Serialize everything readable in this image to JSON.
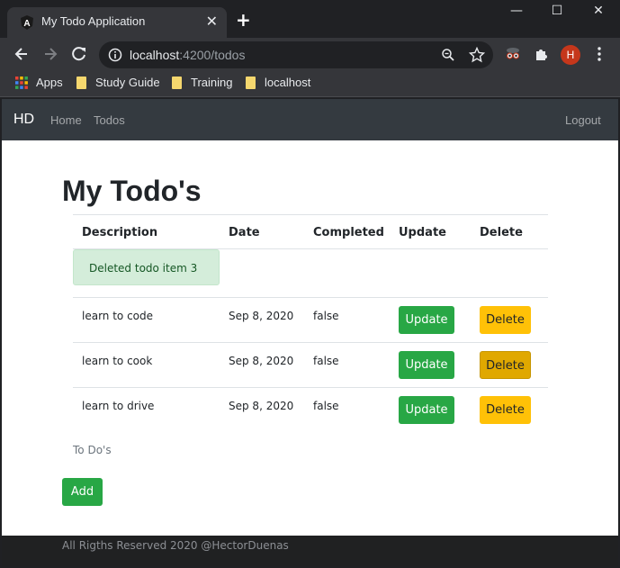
{
  "browser": {
    "tab_title": "My Todo Application",
    "tab_close": "✕",
    "new_tab": "+",
    "url_host": "localhost",
    "url_path": ":4200/todos",
    "profile_initial": "H",
    "window_controls": {
      "minimize": "—",
      "maximize": "☐",
      "close": "✕"
    },
    "bookmarks": [
      "Apps",
      "Study Guide",
      "Training",
      "localhost"
    ]
  },
  "navbar": {
    "brand": "HD",
    "links": [
      "Home",
      "Todos"
    ],
    "logout": "Logout"
  },
  "main": {
    "title": "My Todo's",
    "columns": [
      "Description",
      "Date",
      "Completed",
      "Update",
      "Delete"
    ],
    "alert": "Deleted todo item 3",
    "rows": [
      {
        "description": "learn to code",
        "date": "Sep 8, 2020",
        "completed": "false",
        "update": "Update",
        "delete": "Delete"
      },
      {
        "description": "learn to cook",
        "date": "Sep 8, 2020",
        "completed": "false",
        "update": "Update",
        "delete": "Delete"
      },
      {
        "description": "learn to drive",
        "date": "Sep 8, 2020",
        "completed": "false",
        "update": "Update",
        "delete": "Delete"
      }
    ],
    "caption": "To Do's",
    "add_label": "Add"
  },
  "footer": {
    "text": "All Rigths Reserved 2020 @HectorDuenas"
  },
  "colors": {
    "success": "#28a745",
    "warning": "#ffc107",
    "navbar": "#343a40",
    "alert_bg": "#d4edda"
  }
}
